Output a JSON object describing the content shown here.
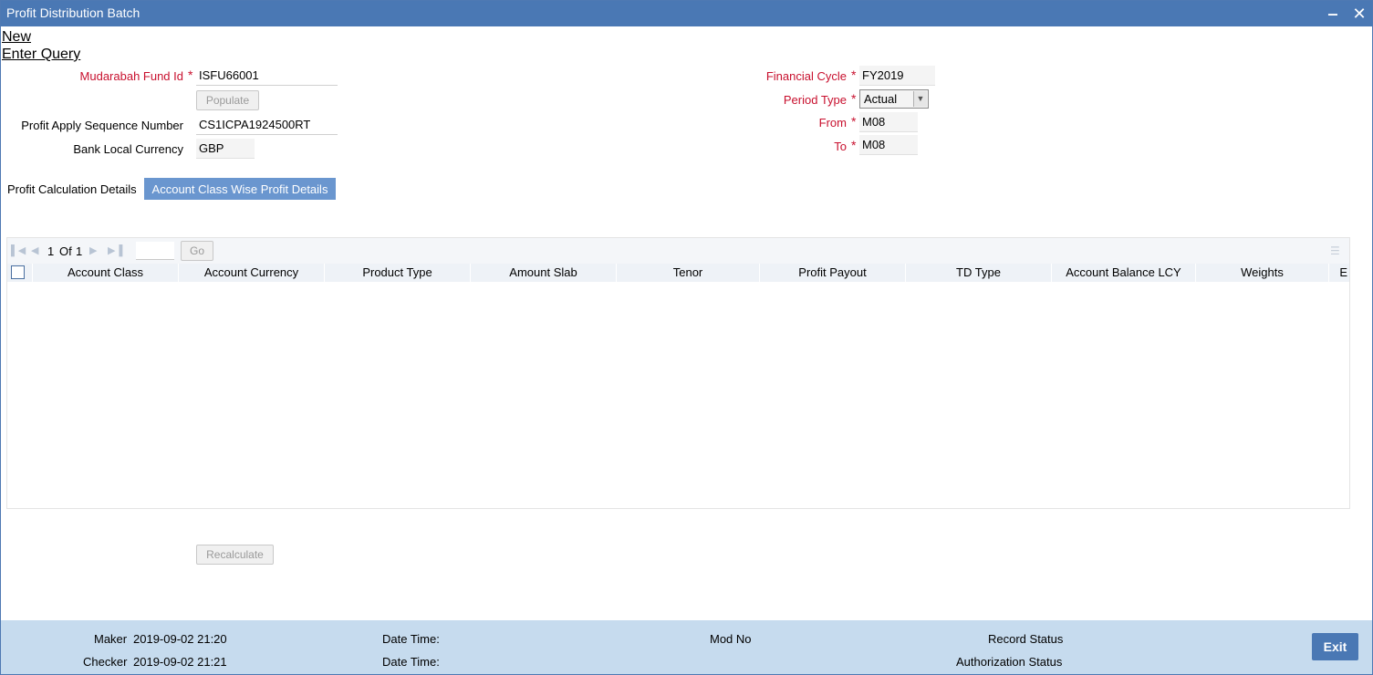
{
  "window": {
    "title": "Profit Distribution Batch",
    "minimize_glyph": "‒",
    "close_glyph": "✕"
  },
  "menu": {
    "new_label": "New",
    "enter_query_label": "Enter Query"
  },
  "form": {
    "mudarabah_fund_id": {
      "label": "Mudarabah Fund Id",
      "value": "ISFU66001"
    },
    "populate_label": "Populate",
    "profit_apply_seq": {
      "label": "Profit Apply Sequence Number",
      "value": "CS1ICPA1924500RT"
    },
    "bank_local_currency": {
      "label": "Bank Local Currency",
      "value": "GBP"
    },
    "financial_cycle": {
      "label": "Financial Cycle",
      "value": "FY2019"
    },
    "period_type": {
      "label": "Period Type",
      "value": "Actual"
    },
    "from": {
      "label": "From",
      "value": "M08"
    },
    "to": {
      "label": "To",
      "value": "M08"
    },
    "required_marker": "*"
  },
  "tabs": [
    {
      "label": "Profit Calculation Details",
      "active": false
    },
    {
      "label": "Account Class Wise Profit Details",
      "active": true
    }
  ],
  "grid": {
    "page_current": "1",
    "page_of": "Of",
    "page_total": "1",
    "go_label": "Go",
    "columns": [
      "Account Class",
      "Account Currency",
      "Product Type",
      "Amount Slab",
      "Tenor",
      "Profit Payout",
      "TD Type",
      "Account Balance LCY",
      "Weights",
      "E"
    ],
    "rows": []
  },
  "recalculate_label": "Recalculate",
  "footer": {
    "maker_label": "Maker",
    "maker_value": "2019-09-02 21:20",
    "checker_label": "Checker",
    "checker_value": "2019-09-02 21:21",
    "date_time_label_1": "Date Time:",
    "date_time_label_2": "Date Time:",
    "mod_no_label": "Mod No",
    "record_status_label": "Record Status",
    "authorization_status_label": "Authorization Status",
    "exit_label": "Exit"
  },
  "colors": {
    "titlebar": "#4a78b4",
    "active_tab": "#6a96cf",
    "required_label": "#c8102e",
    "footer": "#c6dbee"
  }
}
